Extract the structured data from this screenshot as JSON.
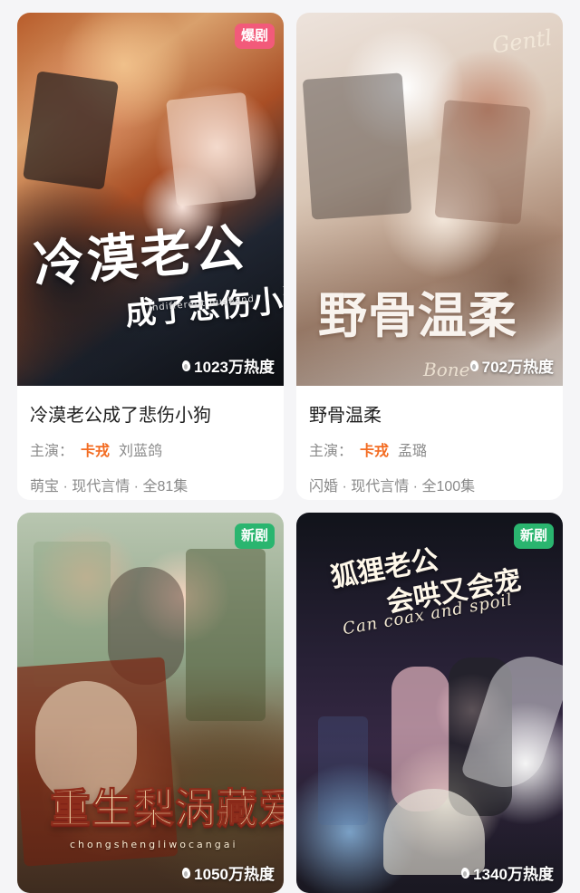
{
  "cards": [
    {
      "badge": "爆剧",
      "badge_color": "#f25a7a",
      "poster_title_line1": "冷漠老公",
      "poster_title_line2": "成了悲伤小狗",
      "poster_subtitle": "Indifferent husband",
      "heat": "1023万热度",
      "title": "冷漠老公成了悲伤小狗",
      "cast_label": "主演：",
      "cast_tag": "卡戎",
      "cast_name": "刘蓝鸽",
      "meta": "萌宝 · 现代言情 · 全81集"
    },
    {
      "poster_title": "野骨温柔",
      "poster_script_top": "Gentl",
      "poster_script_bottom": "Bone",
      "heat": "702万热度",
      "title": "野骨温柔",
      "cast_label": "主演：",
      "cast_tag": "卡戎",
      "cast_name": "孟璐",
      "meta": "闪婚 · 现代言情 · 全100集"
    },
    {
      "badge": "新剧",
      "badge_color": "#2ab56f",
      "poster_title": "重生梨涡藏爱",
      "poster_subtitle": "chongshengliwocangai",
      "heat": "1050万热度"
    },
    {
      "badge": "新剧",
      "badge_color": "#2ab56f",
      "poster_title_line1": "狐狸老公",
      "poster_title_line2": "会哄又会宠",
      "poster_subtitle": "Can coax and spoil",
      "heat": "1340万热度"
    }
  ]
}
